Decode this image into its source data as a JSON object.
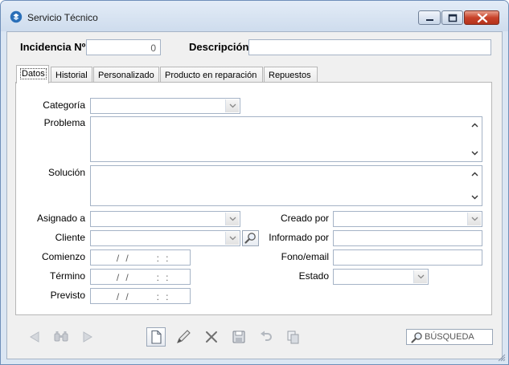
{
  "window": {
    "title": "Servicio Técnico",
    "accent": "#2a6fb8"
  },
  "header": {
    "incidencia_label": "Incidencia Nº",
    "incidencia_value": "0",
    "descripcion_label": "Descripción",
    "descripcion_value": ""
  },
  "tabs": [
    {
      "label": "Datos",
      "active": true
    },
    {
      "label": "Historial",
      "active": false
    },
    {
      "label": "Personalizado",
      "active": false
    },
    {
      "label": "Producto en reparación",
      "active": false
    },
    {
      "label": "Repuestos",
      "active": false
    }
  ],
  "form": {
    "categoria_label": "Categoría",
    "problema_label": "Problema",
    "solucion_label": "Solución",
    "asignado_label": "Asignado a",
    "cliente_label": "Cliente",
    "comienzo_label": "Comienzo",
    "termino_label": "Término",
    "previsto_label": "Previsto",
    "creado_label": "Creado por",
    "informado_label": "Informado por",
    "fono_label": "Fono/email",
    "estado_label": "Estado",
    "date_mask": " /  /         :  :"
  },
  "toolbar": {
    "search_label": "BÚSQUEDA"
  }
}
